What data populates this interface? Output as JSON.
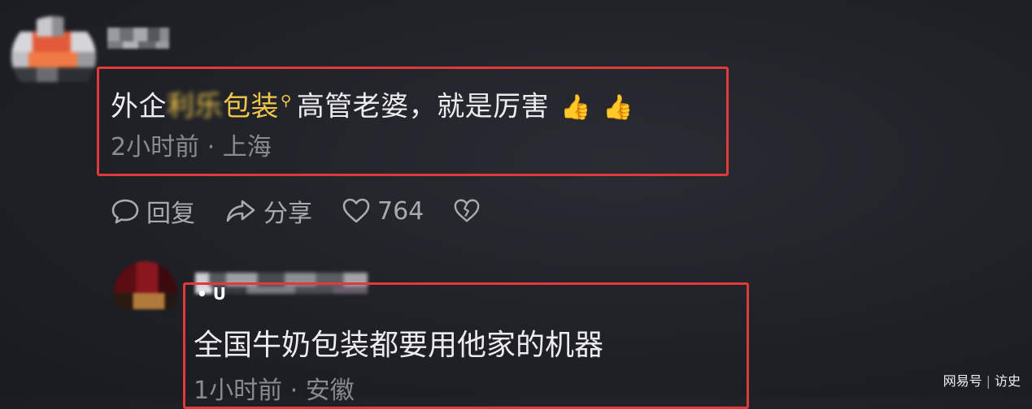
{
  "comment1": {
    "text_prefix": "外企",
    "text_blurred": "利乐",
    "text_highlight": "包装",
    "search_symbol": "⚲",
    "text_suffix": "高管老婆，就是厉害",
    "emoji": "👍",
    "time": "2小时前",
    "separator": "·",
    "location": "上海"
  },
  "actions": {
    "reply_label": "回复",
    "share_label": "分享",
    "like_count": "764"
  },
  "comment2": {
    "tag": "• U",
    "text": "全国牛奶包装都要用他家的机器",
    "time": "1小时前",
    "separator": "·",
    "location": "安徽"
  },
  "watermark": {
    "brand": "网易号",
    "author": "访史"
  },
  "colors": {
    "highlight_box": "#e23a3a",
    "keyword": "#f2c64b",
    "text": "#ececee",
    "meta": "#8a8b90"
  },
  "icons": [
    "comment-bubble-icon",
    "share-arrow-icon",
    "heart-icon",
    "broken-heart-icon",
    "search-icon",
    "thumbs-up-icon"
  ]
}
